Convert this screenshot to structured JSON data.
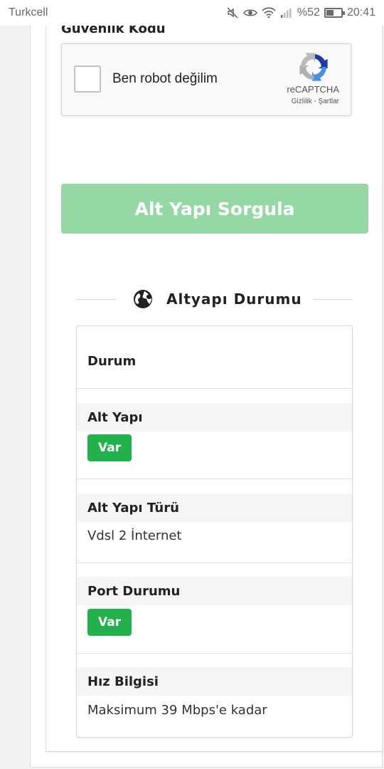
{
  "status_bar": {
    "carrier": "Turkcell",
    "battery_text": "%52",
    "battery_level": 0.52,
    "time": "20:41",
    "icons": [
      "mute-icon",
      "eye-icon",
      "wifi-icon",
      "signal-icon",
      "battery-icon"
    ]
  },
  "form": {
    "security_label": "Güvenlik Kodu",
    "recaptcha": {
      "label": "Ben robot değilim",
      "brand": "reCAPTCHA",
      "links": "Gizlilik - Şartlar",
      "checked": false
    },
    "submit_label": "Alt Yapı Sorgula",
    "submit_color": "#96d8a5"
  },
  "result": {
    "section_title": "Altyapı Durumu",
    "header": "Durum",
    "rows": [
      {
        "title": "Alt Yapı",
        "badge": "Var"
      },
      {
        "title": "Alt Yapı Türü",
        "value": "Vdsl 2 İnternet"
      },
      {
        "title": "Port Durumu",
        "badge": "Var"
      },
      {
        "title": "Hız Bilgisi",
        "value": "Maksimum 39 Mbps'e kadar"
      }
    ],
    "badge_color": "#23b14b"
  }
}
